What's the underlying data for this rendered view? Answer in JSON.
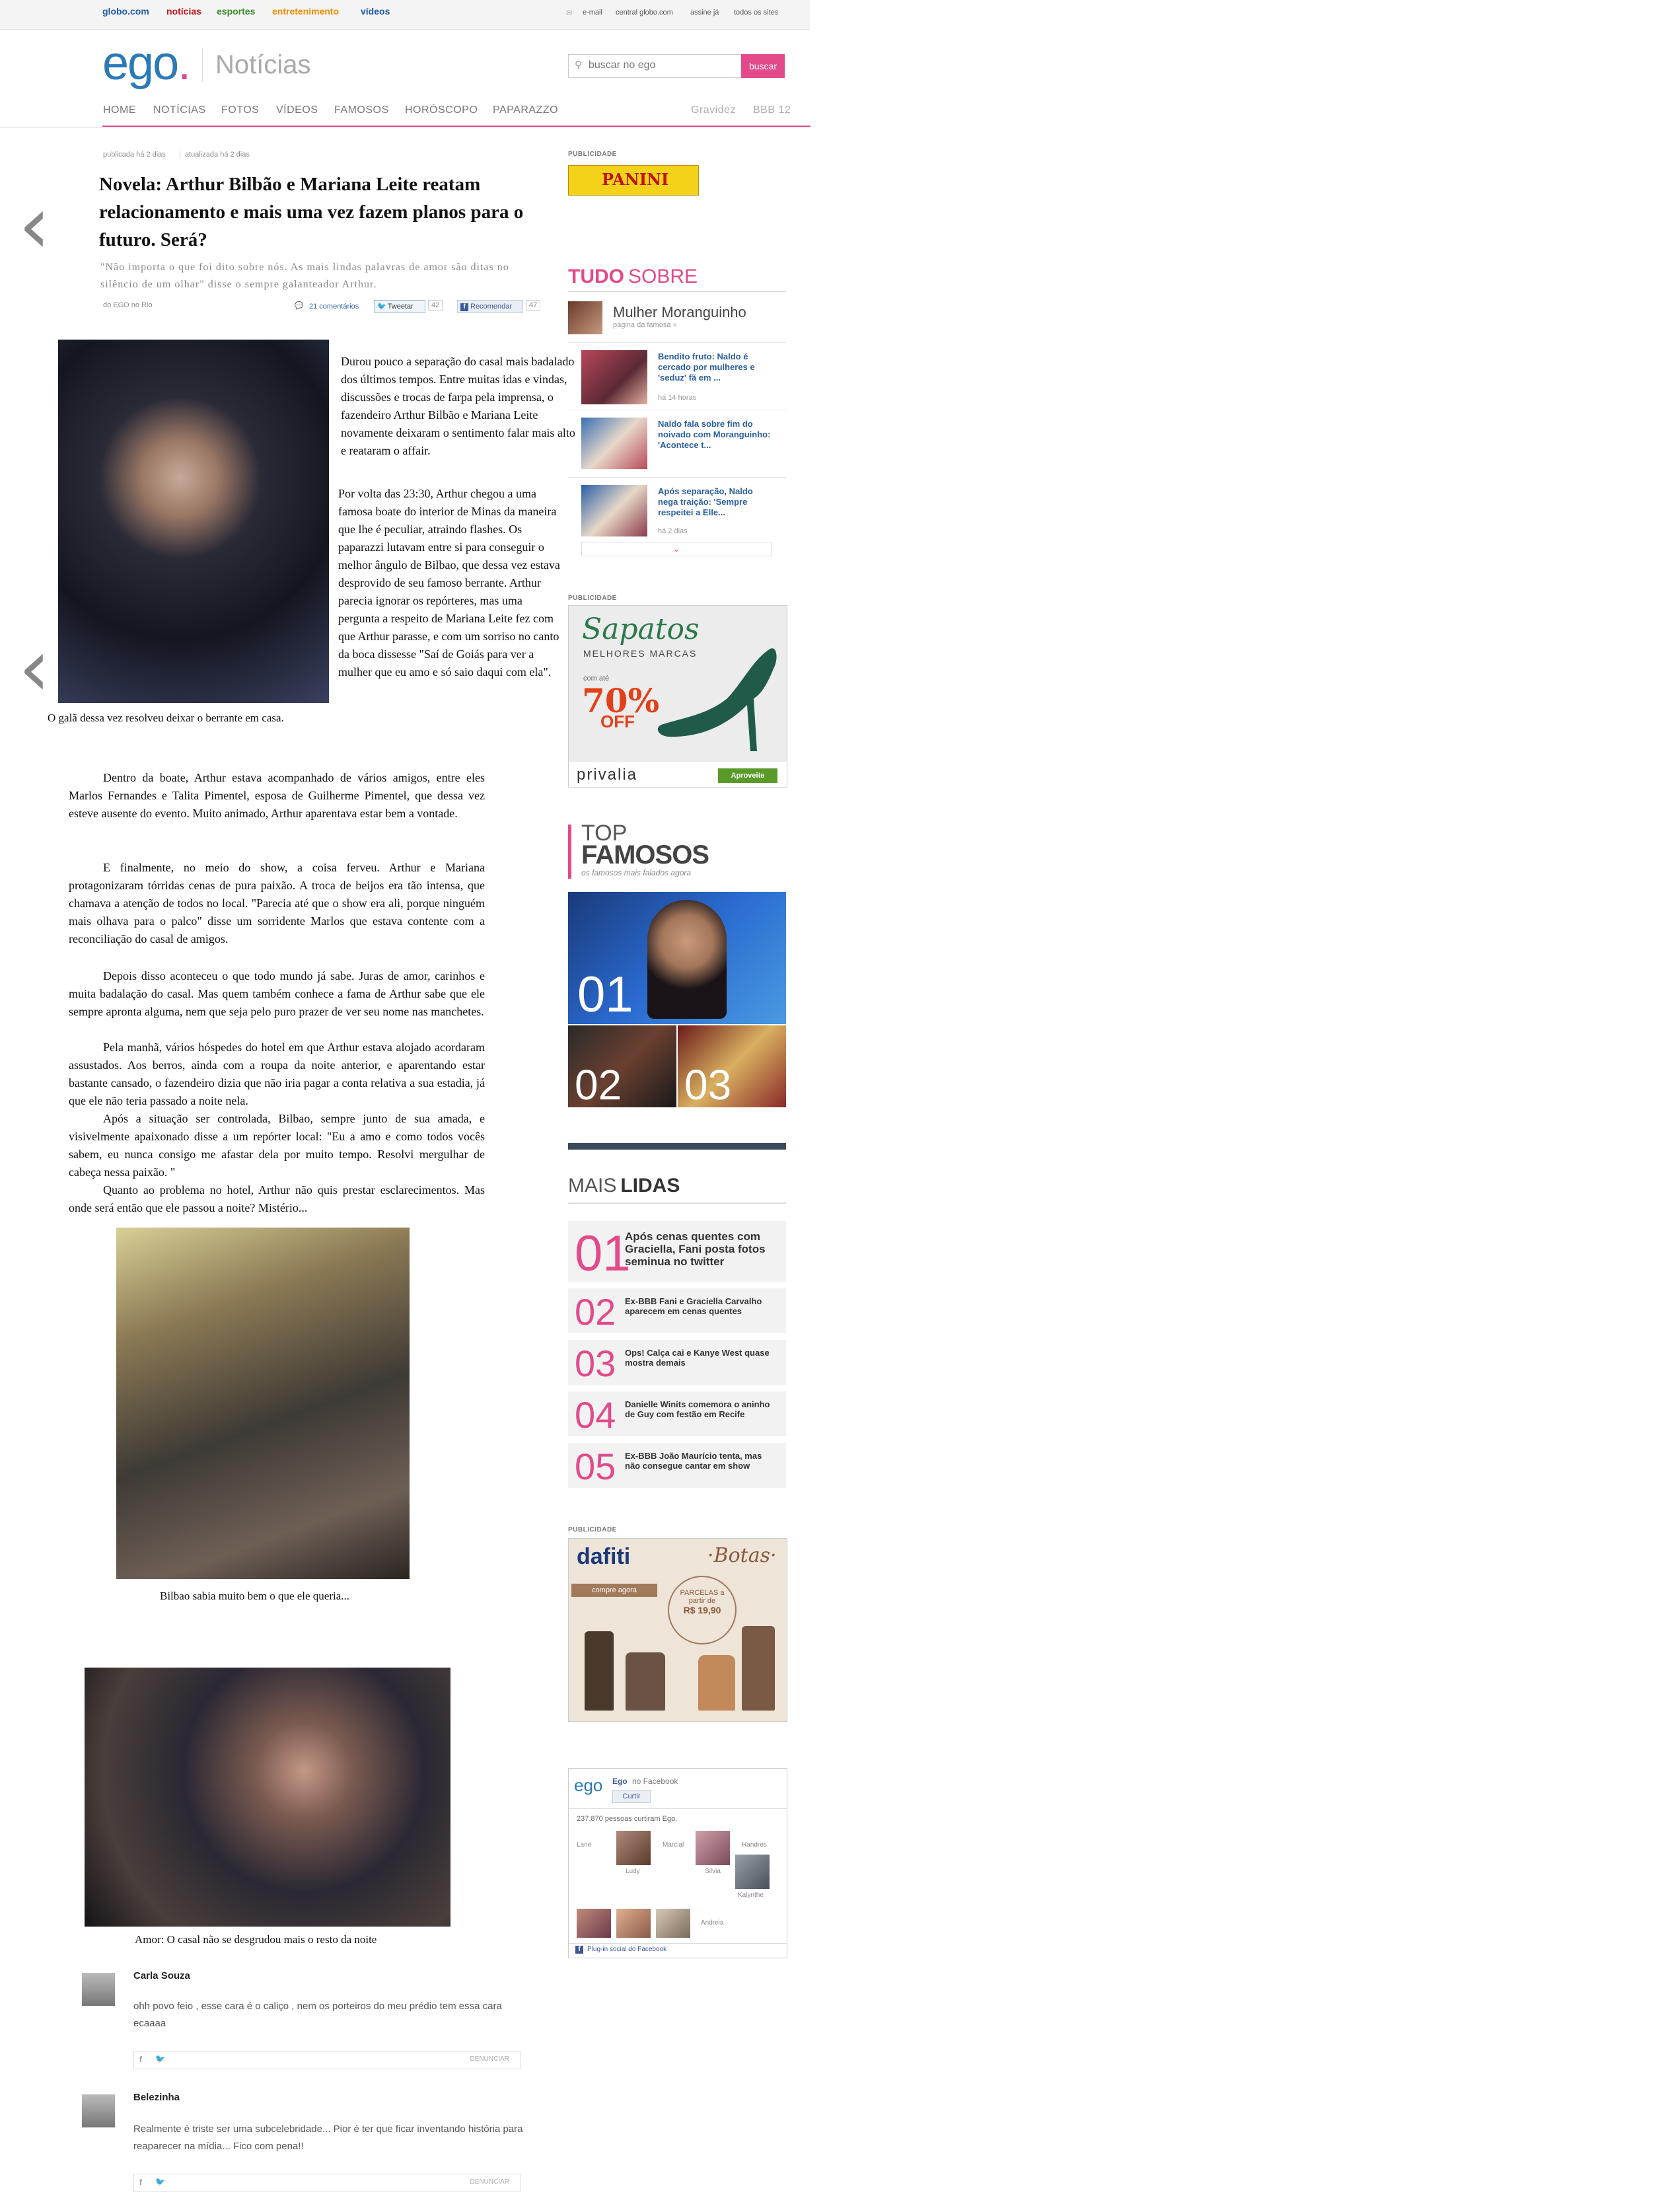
{
  "topbar": {
    "links": [
      {
        "label": "globo.com",
        "color": "#1e5aa8"
      },
      {
        "label": "notícias",
        "color": "#c0141b"
      },
      {
        "label": "esportes",
        "color": "#3a8c2a"
      },
      {
        "label": "entretenimento",
        "color": "#f08c00"
      },
      {
        "label": "vídeos",
        "color": "#1e5aa8"
      }
    ],
    "right": [
      "e-mail",
      "central globo.com",
      "assine já",
      "todos os sites"
    ]
  },
  "header": {
    "logo": "ego",
    "logo_dot": ".",
    "section": "Notícias",
    "search_placeholder": "buscar no ego",
    "search_button": "buscar",
    "nav": [
      "HOME",
      "NOTÍCIAS",
      "FOTOS",
      "VÍDEOS",
      "FAMOSOS",
      "HORÓSCOPO",
      "PAPARAZZO"
    ],
    "nav_right": [
      "Gravidez",
      "BBB 12"
    ]
  },
  "article": {
    "published": "publicada há 2 dias",
    "updated": "atualizada há 2 dias",
    "title": "Novela: Arthur Bilbão e Mariana Leite reatam relacionamento e mais uma vez fazem planos para o futuro. Será?",
    "subtitle": "\"Não importa o que foi dito sobre nós. As mais lindas palavras de amor são ditas no silêncio de um olhar\" disse o sempre galanteador Arthur.",
    "byline": "do EGO no Rio",
    "comments": "21 comentários",
    "tweet": "Tweetar",
    "tweet_count": "42",
    "recommend": "Recomendar",
    "recommend_count": "47",
    "right_col": [
      "Durou pouco a separação do casal mais badalado dos últimos tempos. Entre muitas idas e vindas, discussões e trocas de farpa pela imprensa, o fazendeiro Arthur Bilbão e Mariana Leite novamente deixaram o sentimento falar mais alto e reataram o affair.",
      "Por volta das 23:30, Arthur chegou a uma famosa boate do interior de Minas da maneira que lhe é peculiar, atraindo flashes.  Os paparazzi lutavam entre si para conseguir  o melhor ângulo de Bilbao, que dessa vez estava desprovido de seu famoso berrante. Arthur parecia ignorar os repórteres, mas uma pergunta a respeito de Mariana Leite fez com que Arthur parasse, e com um sorriso no canto da boca dissesse \"Saí de Goiás para  ver a mulher que eu amo e só saio daqui com ela\"."
    ],
    "caption1": "O galã dessa vez resolveu deixar o berrante em casa.",
    "paragraphs": [
      "Dentro da boate, Arthur estava acompanhado de vários amigos, entre eles Marlos Fernandes e Talita Pimentel, esposa de Guilherme Pimentel, que dessa vez esteve ausente do evento. Muito animado, Arthur aparentava estar bem a vontade.",
      "E finalmente, no meio do show,  a coisa ferveu. Arthur e Mariana protagonizaram tórridas cenas de pura paixão. A troca de beijos era tão intensa, que chamava a atenção de todos no local.  \"Parecia até que o show era ali, porque ninguém mais olhava para o palco\" disse um sorridente Marlos que estava contente com a reconciliação do casal de amigos.",
      "Depois disso aconteceu o que todo mundo já sabe. Juras de amor, carinhos e muita badalação do casal. Mas quem também conhece a fama de Arthur sabe que ele sempre apronta alguma, nem que seja pelo puro prazer de ver seu nome nas manchetes.",
      "Pela manhã, vários hóspedes do hotel em que Arthur estava alojado acordaram assustados. Aos berros, ainda com a roupa da noite anterior, e aparentando estar bastante cansado, o fazendeiro dizia que não iria pagar a conta relativa a sua estadia, já que ele não teria passado a noite nela.",
      "Após a situação ser controlada, Bilbao, sempre junto de sua amada, e visivelmente apaixonado disse a um repórter local: \"Eu a amo e como todos vocês sabem, eu nunca consigo me afastar dela por muito tempo. Resolvi mergulhar de cabeça nessa paixão. \"",
      "Quanto ao problema no hotel,  Arthur não quis prestar esclarecimentos. Mas onde será então que ele passou a noite? Mistério..."
    ],
    "caption2": "Bilbao sabia muito bem o que ele queria...",
    "caption3": "Amor: O casal não se desgrudou mais o resto da noite"
  },
  "comments": [
    {
      "name": "Carla Souza",
      "text": "ohh povo feio , esse cara é o caliço , nem os porteiros do meu prédio tem essa cara ecaaaa",
      "report": "DENUNCIAR"
    },
    {
      "name": "Belezinha",
      "text": "Realmente é triste ser uma subcelebridade... Pior é ter que ficar inventando história para reaparecer na mídia... Fico com pena!!",
      "report": "DENUNCIAR"
    }
  ],
  "sidebar": {
    "pub": "PUBLICIDADE",
    "panini": "PANINI",
    "tudo": "TUDO",
    "sobre": "SOBRE",
    "celebrity": "Mulher Moranguinho",
    "celebrity_link": "página da famosa »",
    "news": [
      {
        "title": "Bendito fruto: Naldo é cercado por mulheres e 'seduz' fã em ...",
        "time": "há 14 horas"
      },
      {
        "title": "Naldo fala sobre fim do noivado com Moranguinho: 'Acontece t...",
        "time": ""
      },
      {
        "title": "Após separação, Naldo nega traição: 'Sempre respeitei a Elle...",
        "time": "há 2 dias"
      }
    ],
    "sapatos": {
      "title": "Sapatos",
      "sub": "MELHORES MARCAS",
      "com_ate": "com até",
      "pct": "70%",
      "off": "OFF",
      "brand": "privalia",
      "cta": "Aproveite"
    },
    "top": {
      "top": "TOP",
      "famosos": "FAMOSOS",
      "sub": "os famosos mais falados agora",
      "ranks": [
        "01",
        "02",
        "03"
      ]
    },
    "mais_lidas": {
      "mais": "MAIS",
      "lidas": "LIDAS",
      "items": [
        {
          "n": "01",
          "text": "Após cenas quentes com Graciella, Fani posta fotos seminua no twitter"
        },
        {
          "n": "02",
          "text": "Ex-BBB Fani e Graciella Carvalho aparecem em cenas quentes"
        },
        {
          "n": "03",
          "text": "Ops! Calça cai e Kanye West quase mostra demais"
        },
        {
          "n": "04",
          "text": "Danielle Winits comemora o aninho de Guy com festão em Recife"
        },
        {
          "n": "05",
          "text": "Ex-BBB João Maurício tenta, mas não consegue cantar em show"
        }
      ]
    },
    "dafiti": {
      "brand": "dafiti",
      "botas": "·Botas·",
      "compre": "compre agora",
      "parcelas": "PARCELAS a partir de",
      "price": "R$ 19,90"
    },
    "facebook": {
      "logo": "ego",
      "page": "Ego",
      "on": "no Facebook",
      "like": "Curtir",
      "count_text": "237,870 pessoas curtiram Ego.",
      "names": [
        "Lane",
        "Marcial",
        "Handres",
        "Ludy",
        "Silvia",
        "Kalynthe",
        "Andreia"
      ],
      "plugin": "Plug-in social do Facebook"
    }
  }
}
